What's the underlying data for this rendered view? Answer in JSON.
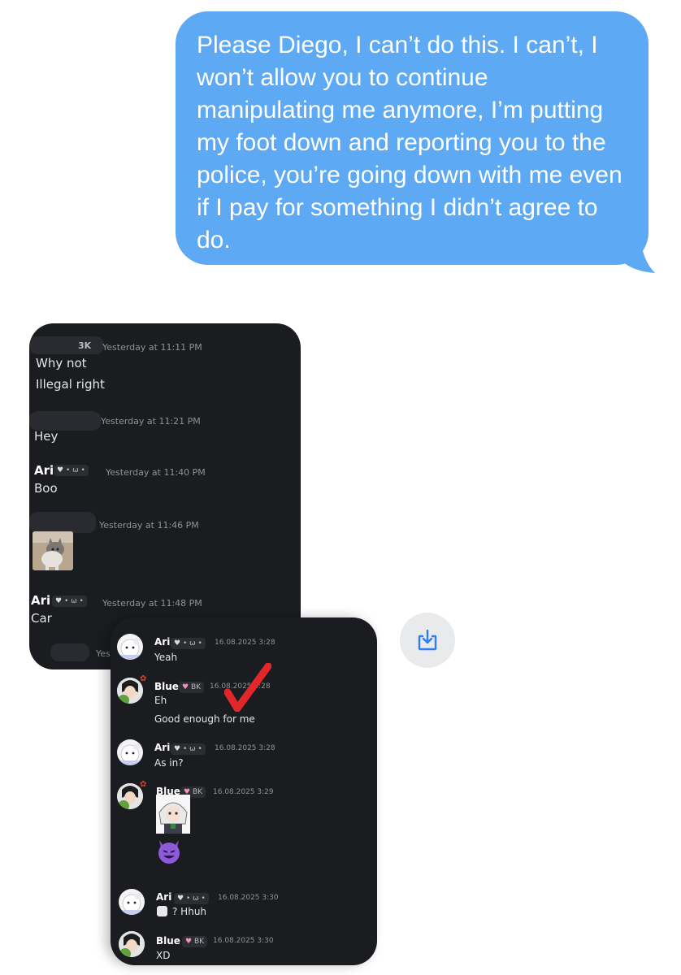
{
  "outgoing_message": {
    "text": "Please Diego, I can’t do this. I can’t, I won’t allow you to continue manipulating me anymore, I’m putting my foot down and reporting you to the police, you’re going down with me even if I pay for something I didn’t agree to do.",
    "color": "#5ea9f3"
  },
  "screenshot1": {
    "messages": [
      {
        "name_fragment": "3K",
        "timestamp": "Yesterday at 11:11 PM",
        "lines": [
          "Why not",
          "Illegal right"
        ]
      },
      {
        "timestamp": "Yesterday at 11:21 PM",
        "lines": [
          "Hey"
        ]
      },
      {
        "name": "Ari",
        "tag": "• ω •",
        "timestamp": "Yesterday at 11:40 PM",
        "lines": [
          "Boo"
        ]
      },
      {
        "timestamp": "Yesterday at 11:46 PM",
        "attachment": "cat-photo"
      },
      {
        "name": "Ari",
        "tag": "• ω •",
        "timestamp": "Yesterday at 11:48 PM",
        "lines": [
          "Car"
        ]
      },
      {
        "timestamp_fragment": "Yes"
      }
    ]
  },
  "screenshot2": {
    "messages": [
      {
        "name": "Ari",
        "tag": "• ω •",
        "timestamp": "16.08.2025 3:28",
        "lines": [
          "Yeah"
        ]
      },
      {
        "name": "Blue",
        "tag": "BK",
        "timestamp": "16.08.2025 3:28",
        "lines": [
          "Eh",
          "Good enough for me"
        ]
      },
      {
        "name": "Ari",
        "tag": "• ω •",
        "timestamp": "16.08.2025 3:28",
        "lines": [
          "As in?"
        ]
      },
      {
        "name": "Blue",
        "tag": "BK",
        "timestamp": "16.08.2025 3:29",
        "attachments": [
          "anime-sticker",
          "smiling-devil-emoji"
        ]
      },
      {
        "name": "Ari",
        "tag": "• ω •",
        "timestamp": "16.08.2025 3:30",
        "lines": [
          "? Hhuh"
        ]
      },
      {
        "name": "Blue",
        "tag": "BK",
        "timestamp": "16.08.2025 3:30",
        "lines": [
          "XD"
        ]
      }
    ]
  },
  "download_button": {
    "icon": "download-icon",
    "color": "#2f7cf6"
  }
}
